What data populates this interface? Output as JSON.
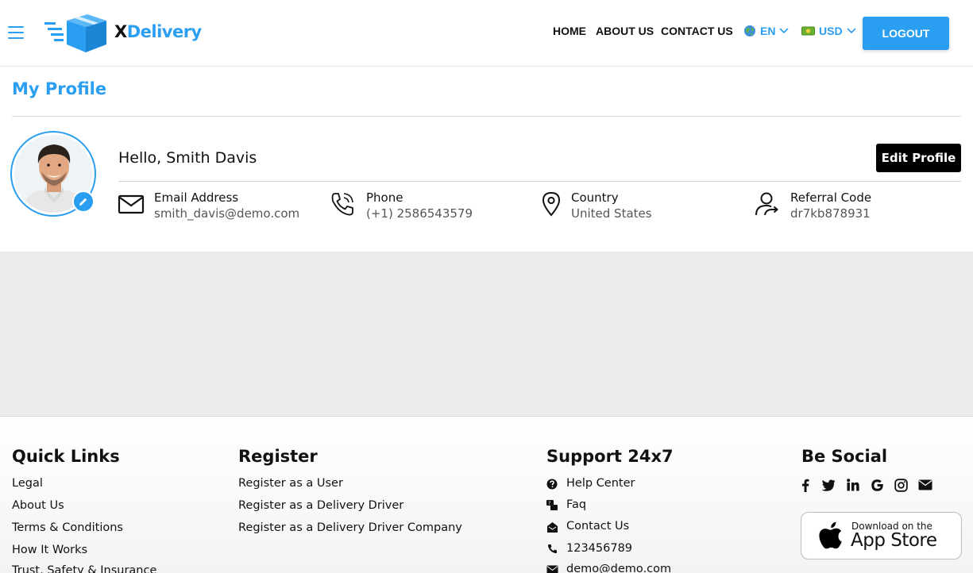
{
  "header": {
    "logo_x": "X",
    "logo_rest": "Delivery",
    "nav": [
      "HOME",
      "ABOUT US",
      "CONTACT US"
    ],
    "language": "EN",
    "currency": "USD",
    "logout_label": "LOGOUT"
  },
  "page": {
    "title": "My Profile"
  },
  "profile": {
    "greeting": "Hello, Smith Davis",
    "edit_label": "Edit Profile",
    "fields": [
      {
        "label": "Email Address",
        "value": "smith_davis@demo.com"
      },
      {
        "label": "Phone",
        "value": "(+1) 2586543579"
      },
      {
        "label": "Country",
        "value": "United States"
      },
      {
        "label": "Referral Code",
        "value": "dr7kb878931"
      }
    ]
  },
  "footer": {
    "quick_links": {
      "title": "Quick Links",
      "items": [
        "Legal",
        "About Us",
        "Terms & Conditions",
        "How It Works",
        "Trust, Safety & Insurance"
      ]
    },
    "register": {
      "title": "Register",
      "items": [
        "Register as a User",
        "Register as a Delivery Driver",
        "Register as a Delivery Driver Company"
      ]
    },
    "support": {
      "title": "Support 24x7",
      "items": [
        "Help Center",
        "Faq",
        "Contact Us",
        "123456789",
        "demo@demo.com"
      ]
    },
    "social": {
      "title": "Be Social",
      "icons": [
        "facebook-icon",
        "twitter-icon",
        "linkedin-icon",
        "google-icon",
        "instagram-icon",
        "envelope-icon"
      ]
    },
    "app_store": {
      "small": "Download on the",
      "big": "App Store"
    }
  },
  "colors": {
    "accent": "#2a9ef0",
    "dark": "#000000",
    "band": "#ececec"
  }
}
